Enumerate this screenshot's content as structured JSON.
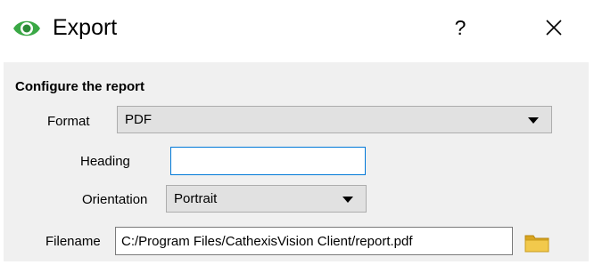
{
  "window": {
    "title": "Export",
    "help_label": "?",
    "app_icon": "eye-icon",
    "close_icon": "close-icon"
  },
  "section": {
    "title": "Configure the report"
  },
  "form": {
    "format": {
      "label": "Format",
      "value": "PDF"
    },
    "heading": {
      "label": "Heading",
      "value": ""
    },
    "orientation": {
      "label": "Orientation",
      "value": "Portrait"
    },
    "filename": {
      "label": "Filename",
      "value": "C:/Program Files/CathexisVision Client/report.pdf",
      "browse_icon": "folder-icon"
    }
  },
  "colors": {
    "accent": "#0078d7",
    "icon_green": "#3aa845",
    "folder_yellow": "#f2c94c"
  }
}
